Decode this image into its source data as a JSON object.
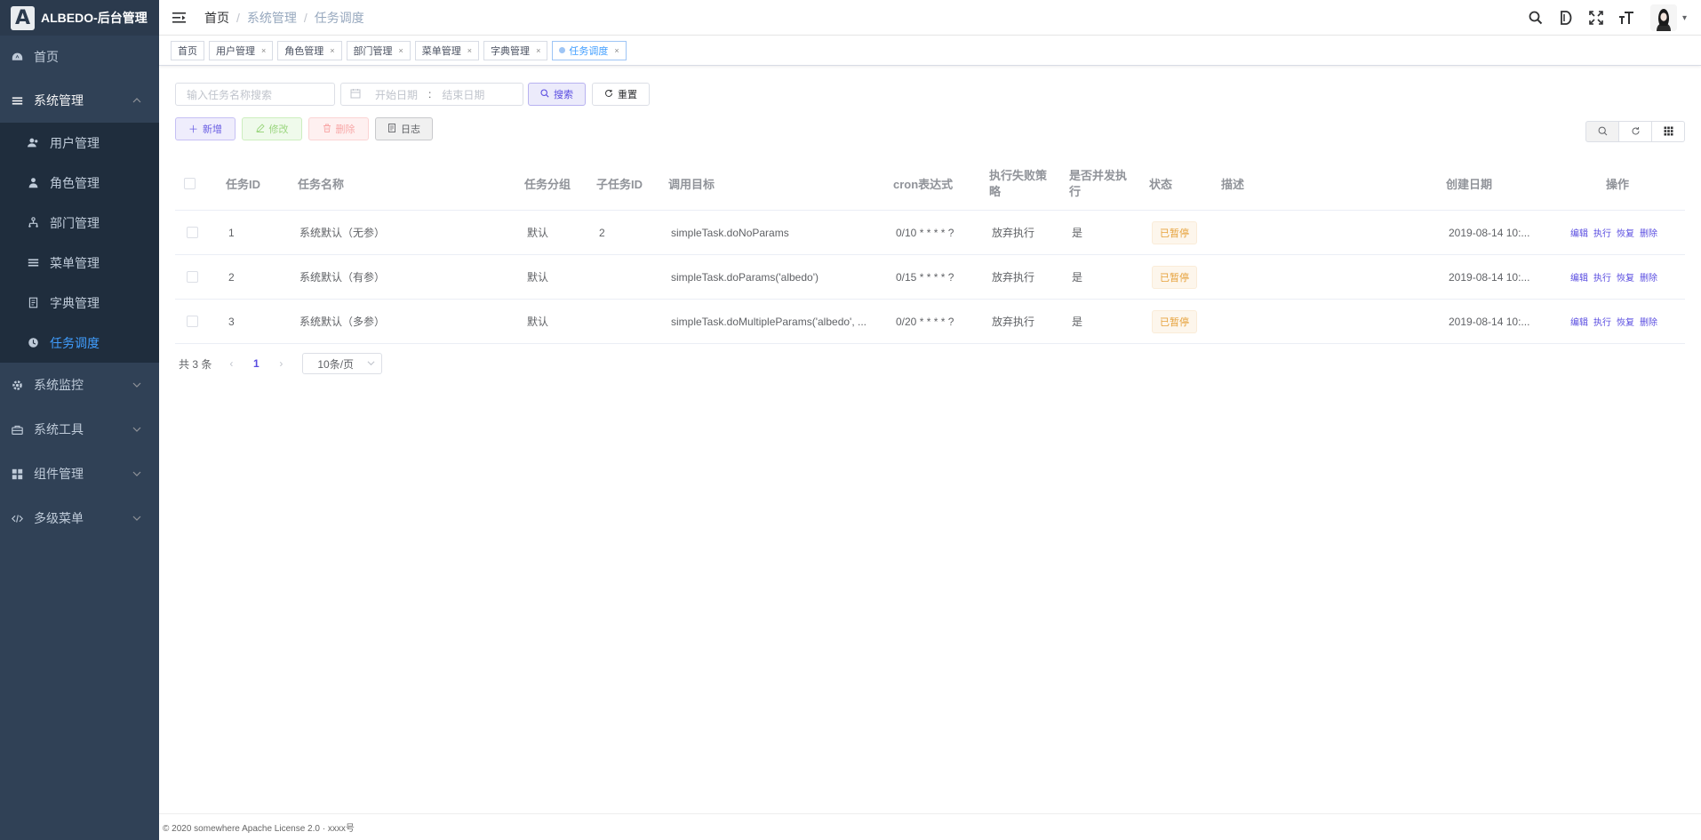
{
  "app": {
    "title": "ALBEDO-后台管理",
    "logo_letter": "A"
  },
  "sidebar": {
    "items": [
      {
        "label": "首页",
        "icon": "dashboard-icon"
      },
      {
        "label": "系统管理",
        "icon": "menu-list-icon",
        "expanded": true
      },
      {
        "label": "系统监控",
        "icon": "monitor-gear-icon"
      },
      {
        "label": "系统工具",
        "icon": "toolbox-icon"
      },
      {
        "label": "组件管理",
        "icon": "grid-icon"
      },
      {
        "label": "多级菜单",
        "icon": "code-icon"
      }
    ],
    "system_sub": [
      {
        "label": "用户管理",
        "icon": "users-icon"
      },
      {
        "label": "角色管理",
        "icon": "role-icon"
      },
      {
        "label": "部门管理",
        "icon": "dept-icon"
      },
      {
        "label": "菜单管理",
        "icon": "menu-icon"
      },
      {
        "label": "字典管理",
        "icon": "dict-icon"
      },
      {
        "label": "任务调度",
        "icon": "clock-icon",
        "active": true
      }
    ]
  },
  "navbar": {
    "breadcrumb": [
      "首页",
      "系统管理",
      "任务调度"
    ]
  },
  "tags": [
    "首页",
    "用户管理",
    "角色管理",
    "部门管理",
    "菜单管理",
    "字典管理",
    "任务调度"
  ],
  "search": {
    "name_placeholder": "输入任务名称搜索",
    "start_placeholder": "开始日期",
    "range_sep": ":",
    "end_placeholder": "结束日期",
    "search_label": "搜索",
    "reset_label": "重置"
  },
  "toolbar": {
    "add_label": "新增",
    "edit_label": "修改",
    "delete_label": "删除",
    "log_label": "日志"
  },
  "table": {
    "headers": {
      "id": "任务ID",
      "name": "任务名称",
      "group": "任务分组",
      "sub_id": "子任务ID",
      "target": "调用目标",
      "cron": "cron表达式",
      "misfire": "执行失败策略",
      "concurrent": "是否并发执行",
      "status": "状态",
      "desc": "描述",
      "created": "创建日期",
      "ops": "操作"
    },
    "rows": [
      {
        "id": "1",
        "name": "系统默认（无参）",
        "group": "默认",
        "sub_id": "2",
        "target": "simpleTask.doNoParams",
        "cron": "0/10 * * * * ?",
        "misfire": "放弃执行",
        "concurrent": "是",
        "status": "已暂停",
        "desc": "",
        "created": "2019-08-14 10:..."
      },
      {
        "id": "2",
        "name": "系统默认（有参）",
        "group": "默认",
        "sub_id": "",
        "target": "simpleTask.doParams('albedo')",
        "cron": "0/15 * * * * ?",
        "misfire": "放弃执行",
        "concurrent": "是",
        "status": "已暂停",
        "desc": "",
        "created": "2019-08-14 10:..."
      },
      {
        "id": "3",
        "name": "系统默认（多参）",
        "group": "默认",
        "sub_id": "",
        "target": "simpleTask.doMultipleParams('albedo', ...",
        "cron": "0/20 * * * * ?",
        "misfire": "放弃执行",
        "concurrent": "是",
        "status": "已暂停",
        "desc": "",
        "created": "2019-08-14 10:..."
      }
    ],
    "ops": [
      "编辑",
      "执行",
      "恢复",
      "删除"
    ]
  },
  "pagination": {
    "total_text": "共 3 条",
    "current": "1",
    "page_size": "10条/页"
  },
  "footer": {
    "text": "© 2020 somewhere Apache License 2.0 · xxxx号"
  },
  "colors": {
    "sidebar_bg": "#304156",
    "submenu_bg": "#1f2d3d",
    "active": "#409eff",
    "primary": "#5a4de0",
    "warning": "#e6a23c"
  }
}
